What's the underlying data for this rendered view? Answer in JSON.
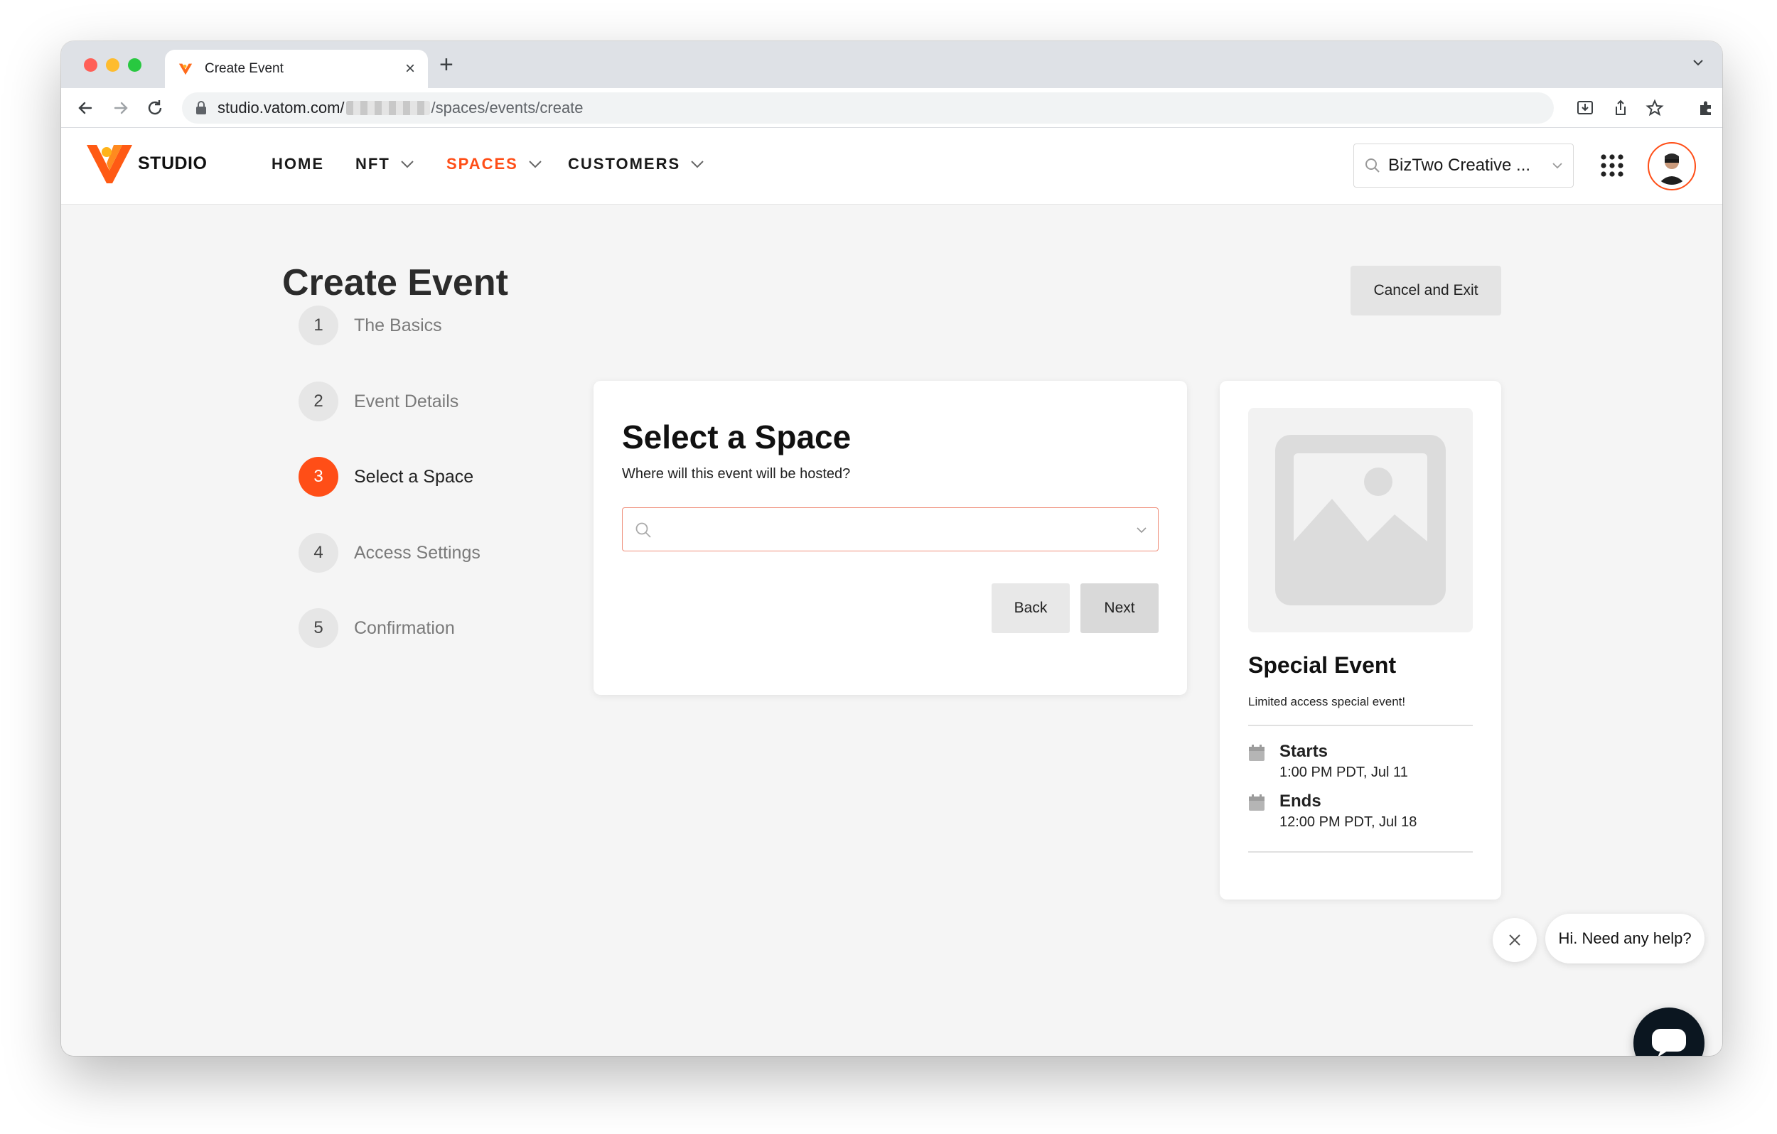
{
  "browser": {
    "tab_title": "Create Event",
    "url_host": "studio.vatom.com/",
    "url_path": "/spaces/events/create"
  },
  "app": {
    "logo_text": "STUDIO",
    "brand_color": "#ff4e17",
    "nav": [
      {
        "label": "HOME",
        "active": false,
        "dropdown": false
      },
      {
        "label": "NFT",
        "active": false,
        "dropdown": true
      },
      {
        "label": "SPACES",
        "active": true,
        "dropdown": true
      },
      {
        "label": "CUSTOMERS",
        "active": false,
        "dropdown": true
      }
    ],
    "org_selector": "BizTwo Creative ..."
  },
  "page": {
    "title": "Create Event",
    "cancel_label": "Cancel and Exit",
    "steps": [
      {
        "num": "1",
        "label": "The Basics",
        "active": false
      },
      {
        "num": "2",
        "label": "Event Details",
        "active": false
      },
      {
        "num": "3",
        "label": "Select a Space",
        "active": true
      },
      {
        "num": "4",
        "label": "Access Settings",
        "active": false
      },
      {
        "num": "5",
        "label": "Confirmation",
        "active": false
      }
    ],
    "form": {
      "title": "Select a Space",
      "subtitle": "Where will this event will be hosted?",
      "space_value": "",
      "back_label": "Back",
      "next_label": "Next"
    },
    "preview": {
      "title": "Special Event",
      "description": "Limited access special event!",
      "starts_label": "Starts",
      "starts_value": "1:00 PM PDT, Jul 11",
      "ends_label": "Ends",
      "ends_value": "12:00 PM PDT, Jul 18"
    }
  },
  "help": {
    "bubble_text": "Hi. Need any help?"
  }
}
